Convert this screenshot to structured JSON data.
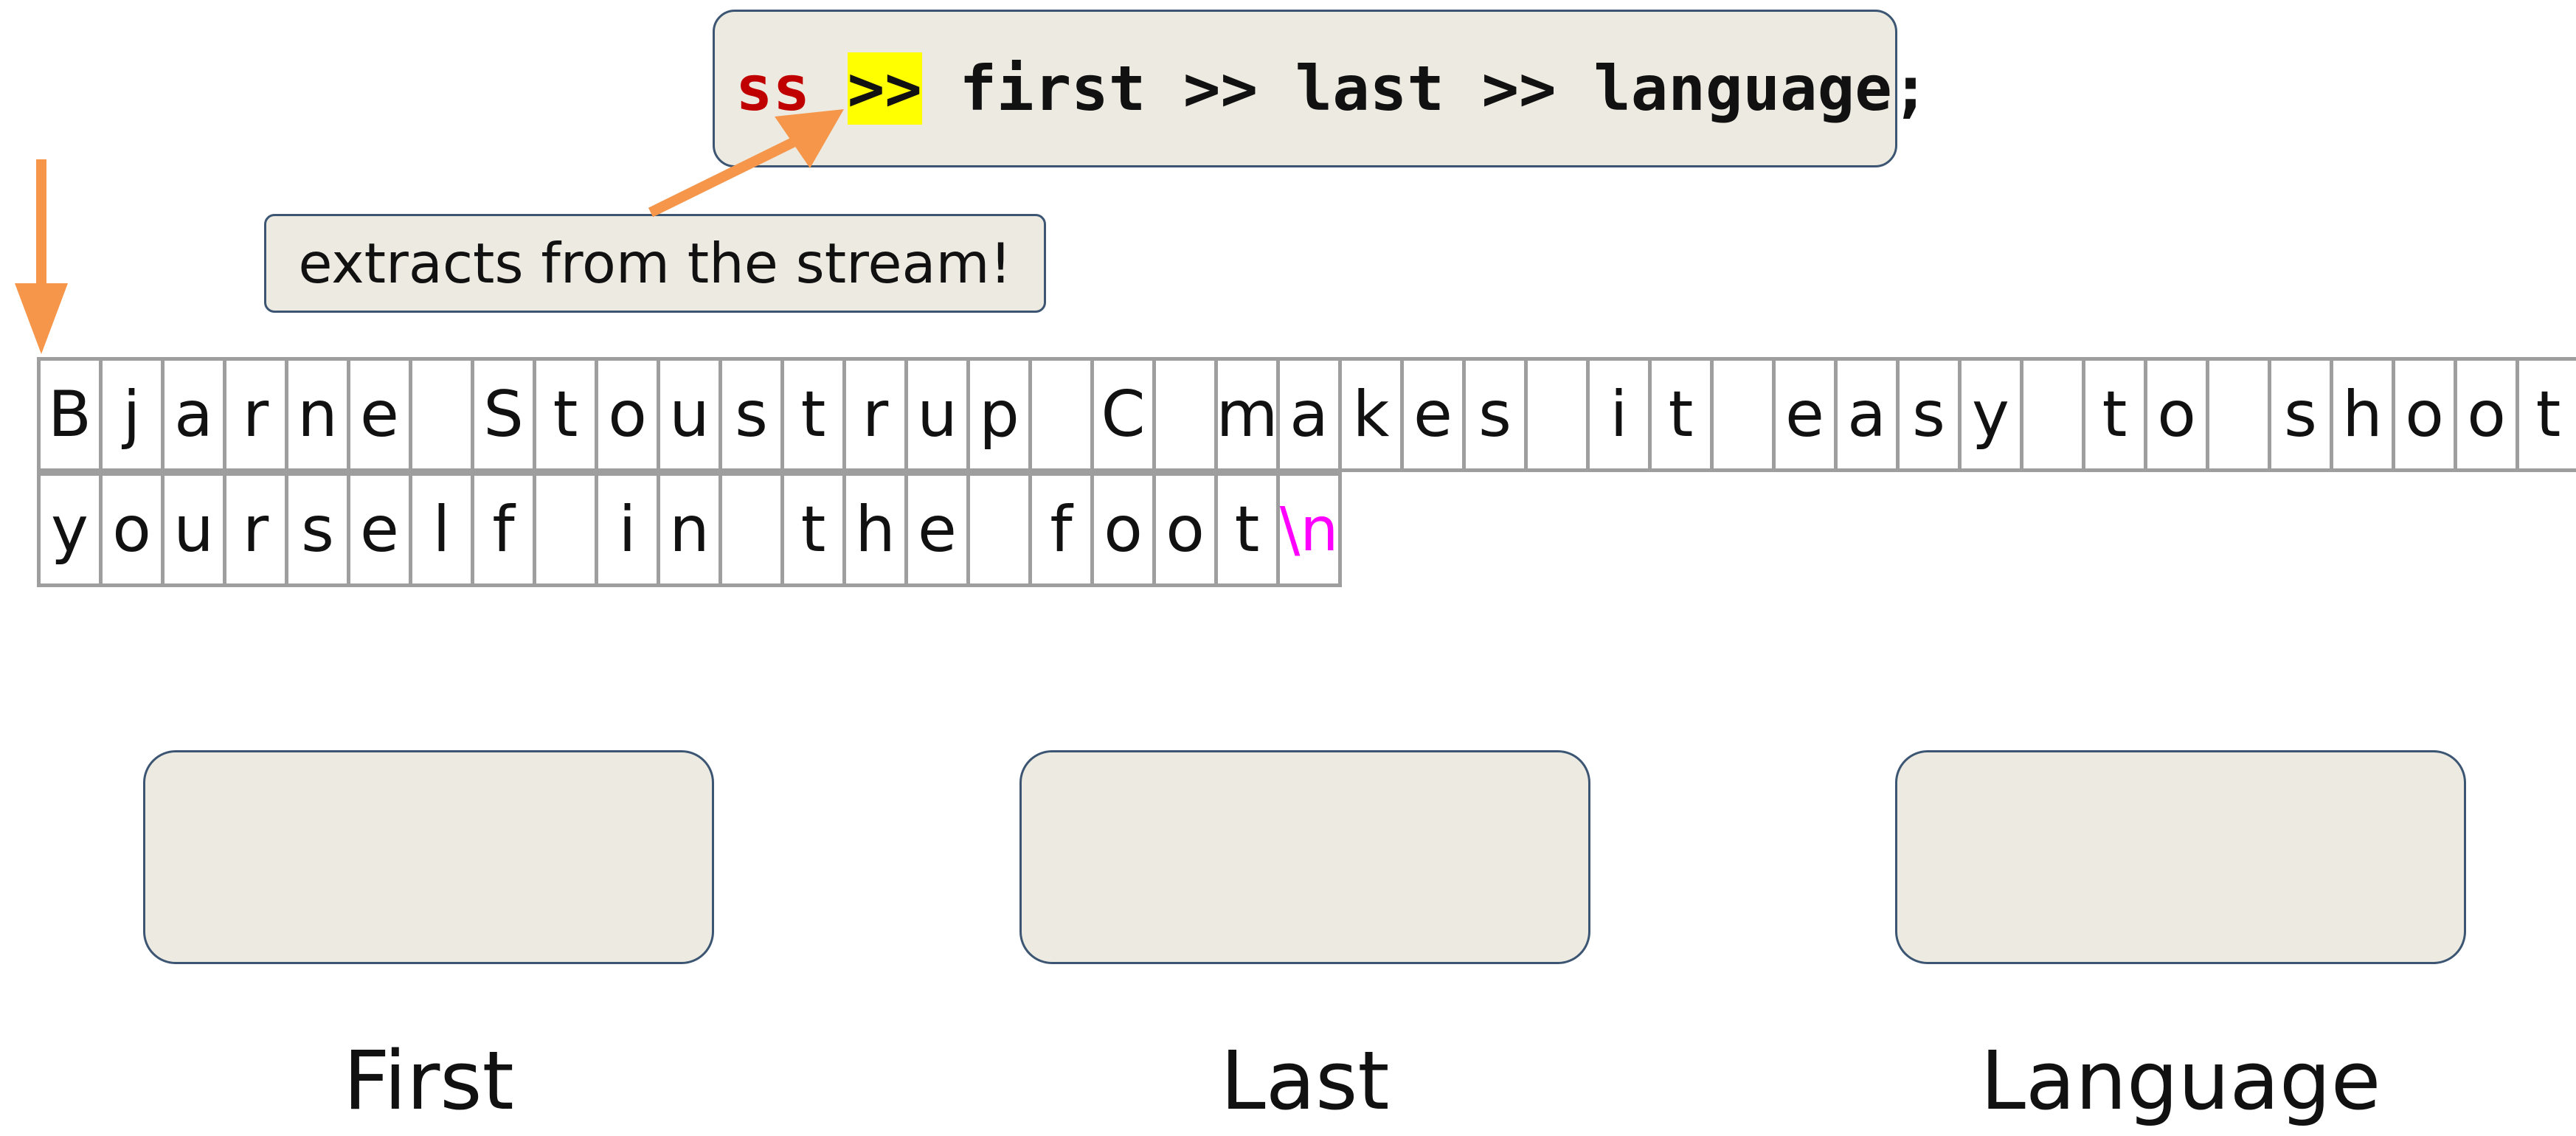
{
  "code": {
    "object": "ss",
    "operator": ">>",
    "rest": "first >> last >> language;"
  },
  "callout": {
    "text": "extracts from the stream!"
  },
  "stream": {
    "rows": [
      [
        "B",
        "j",
        "a",
        "r",
        "n",
        "e",
        " ",
        "S",
        "t",
        "o",
        "u",
        "s",
        "t",
        "r",
        "u",
        "p",
        " ",
        "C",
        " ",
        "m",
        "a",
        "k",
        "e",
        "s",
        " ",
        "i",
        "t",
        " ",
        "e",
        "a",
        "s",
        "y",
        " ",
        "t",
        "o",
        " ",
        "s",
        "h",
        "o",
        "o",
        "t",
        " "
      ],
      [
        "y",
        "o",
        "u",
        "r",
        "s",
        "e",
        "l",
        "f",
        " ",
        "i",
        "n",
        " ",
        "t",
        "h",
        "e",
        " ",
        "f",
        "o",
        "o",
        "t",
        "\\n"
      ]
    ],
    "special_token": "\\n"
  },
  "variables": [
    {
      "label": "First"
    },
    {
      "label": "Last"
    },
    {
      "label": "Language"
    }
  ],
  "colors": {
    "arrow": "#f5964b",
    "box_fill": "#edebe1",
    "box_border": "#3b5573",
    "cell_border": "#9e9e9e",
    "code_object": "#c00000",
    "highlight": "#ffff00",
    "special_char": "#ff00ff"
  }
}
